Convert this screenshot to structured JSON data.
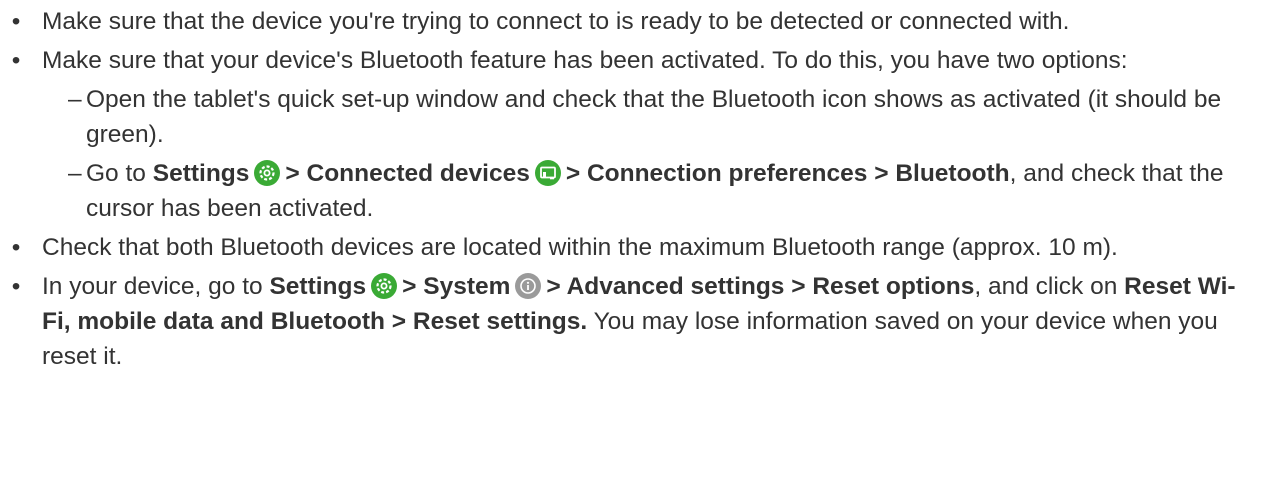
{
  "items": [
    {
      "text": "Make sure that the device you're trying to connect to is ready to be detected or connected with."
    },
    {
      "text": "Make sure that your device's Bluetooth feature has been activated. To do this, you have two options:",
      "sub1": "Open the tablet's quick set-up window and check that the Bluetooth icon shows as activated (it should be green).",
      "sub2_prefix": "Go to",
      "sub2_settings": "Settings",
      "sub2_connected": "> Connected devices",
      "sub2_prefs": "> Connection preferences > Bluetooth",
      "sub2_suffix": ", and check that the cursor has been activated."
    },
    {
      "text": "Check that both Bluetooth devices are located within the maximum Bluetooth range (approx. 10 m)."
    },
    {
      "prefix": "In your device, go to",
      "settings": "Settings",
      "system": "> System",
      "path": "> Advanced settings > Reset options",
      "mid": ", and click on",
      "reset": "Reset Wi-Fi, mobile data and Bluetooth > Reset settings.",
      "suffix": "You may lose information saved on your device when you reset it."
    }
  ],
  "icons": {
    "settings": "gear-icon",
    "connected_devices": "connected-devices-icon",
    "system": "info-icon"
  },
  "colors": {
    "text": "#333333",
    "settings_green": "#3aaa35",
    "system_gray": "#9a9a9a"
  }
}
